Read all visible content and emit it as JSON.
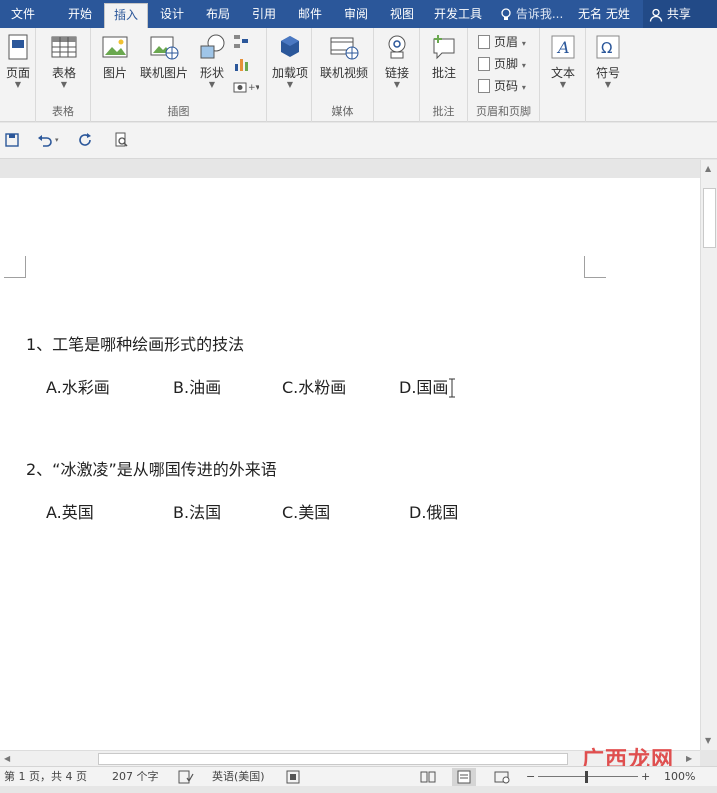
{
  "tabs": [
    "文件",
    "开始",
    "插入",
    "设计",
    "布局",
    "引用",
    "邮件",
    "审阅",
    "视图",
    "开发工具"
  ],
  "active_tab": "插入",
  "tell_me": "告诉我...",
  "user_name": "无名 无姓",
  "share_label": "共享",
  "ribbon": {
    "pages": {
      "label": "页面",
      "group": ""
    },
    "tables": {
      "label": "表格",
      "group": "表格"
    },
    "illustrations": {
      "group": "插图",
      "picture": "图片",
      "online_picture": "联机图片",
      "shapes": "形状"
    },
    "addins": {
      "label": "加载项"
    },
    "media": {
      "group": "媒体",
      "online_video": "联机视频"
    },
    "links": {
      "label": "链接"
    },
    "comments": {
      "group": "批注",
      "comment": "批注"
    },
    "header_footer": {
      "group": "页眉和页脚",
      "header": "页眉",
      "footer": "页脚",
      "page_number": "页码"
    },
    "text": {
      "label": "文本"
    },
    "symbols": {
      "label": "符号"
    }
  },
  "document": {
    "q1": "1、工笔是哪种绘画形式的技法",
    "q1_options": [
      "A.水彩画",
      "B.油画",
      "C.水粉画",
      "D.国画"
    ],
    "q2": "2、“冰激凌”是从哪国传进的外来语",
    "q2_options": [
      "A.英国",
      "B.法国",
      "C.美国",
      "D.俄国"
    ]
  },
  "status": {
    "page_info": "第 1 页，共 4 页",
    "word_count": "207 个字",
    "language": "英语(美国)",
    "zoom": "100%"
  },
  "watermark": "广西龙网",
  "colors": {
    "accent": "#2b579a",
    "ribbon_bg": "#f3f3f3"
  }
}
